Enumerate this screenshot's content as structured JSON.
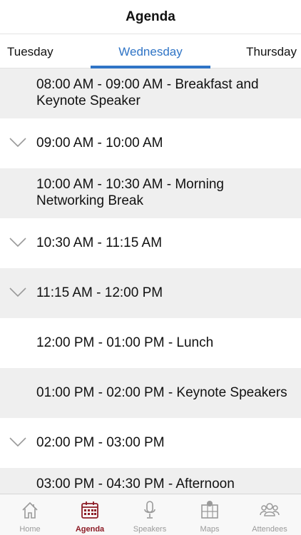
{
  "header": {
    "title": "Agenda"
  },
  "tabs": [
    {
      "label": "Tuesday"
    },
    {
      "label": "Wednesday",
      "active": true
    },
    {
      "label": "Thursday"
    }
  ],
  "agenda": [
    {
      "line1": "08:00 AM - 09:00 AM - Breakfast and",
      "line2": "Keynote Speaker",
      "expandable": false
    },
    {
      "line1": "09:00 AM - 10:00 AM",
      "expandable": true
    },
    {
      "line1": "10:00 AM - 10:30 AM - Morning",
      "line2": "Networking Break",
      "expandable": false
    },
    {
      "line1": "10:30 AM - 11:15 AM",
      "expandable": true
    },
    {
      "line1": "11:15 AM - 12:00 PM",
      "expandable": true
    },
    {
      "line1": "12:00 PM - 01:00 PM - Lunch",
      "expandable": false
    },
    {
      "line1": "01:00 PM - 02:00 PM - Keynote Speakers",
      "expandable": false
    },
    {
      "line1": "02:00 PM - 03:00 PM",
      "expandable": true
    },
    {
      "line1": "03:00 PM - 04:30 PM - Afternoon",
      "line2": "",
      "expandable": false
    }
  ],
  "tabbar": {
    "items": [
      {
        "label": "Home",
        "icon": "home-icon"
      },
      {
        "label": "Agenda",
        "icon": "calendar-icon",
        "active": true
      },
      {
        "label": "Speakers",
        "icon": "microphone-icon"
      },
      {
        "label": "Maps",
        "icon": "map-icon"
      },
      {
        "label": "Attendees",
        "icon": "people-icon"
      }
    ]
  },
  "colors": {
    "accent": "#2f74c6",
    "active_tab": "#8d1c26",
    "row_alt": "#efefef",
    "inactive": "#9a9a9a"
  }
}
